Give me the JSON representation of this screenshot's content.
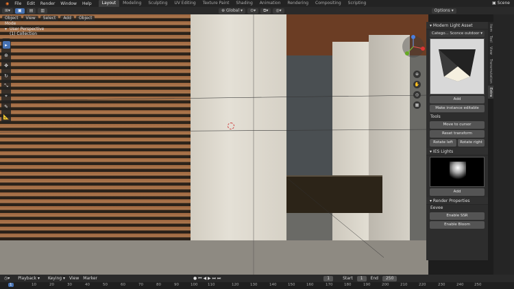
{
  "menu": [
    "File",
    "Edit",
    "Render",
    "Window",
    "Help"
  ],
  "workspaces": [
    "Layout",
    "Modeling",
    "Sculpting",
    "UV Editing",
    "Texture Paint",
    "Shading",
    "Animation",
    "Rendering",
    "Compositing",
    "Scripting"
  ],
  "active_workspace": "Layout",
  "scene_label": "Scene",
  "header": {
    "transform_orientation": "Global",
    "options": "Options"
  },
  "viewport_header": {
    "mode": "Object Mode",
    "view": "View",
    "select": "Select",
    "add": "Add",
    "object": "Object"
  },
  "viewport_overlay": {
    "line1": "User Perspective",
    "line2": "(1) Collection"
  },
  "sidebar": {
    "tabs": [
      "Item",
      "Tool",
      "View",
      "Transmutation",
      "Extra"
    ],
    "panel1_title": "Modern Light Asset",
    "category_label": "Catego...",
    "category_value": "Sconce outdoor",
    "add_button": "Add",
    "make_instance_button": "Make instance editable",
    "tools_label": "Tools",
    "move_to_cursor": "Move to cursor",
    "reset_transform": "Reset transform",
    "rotate_left": "Rotate left",
    "rotate_right": "Rotate right",
    "panel2_title": "IES Lights",
    "add_button2": "Add",
    "panel3_title": "Render Properties",
    "engine_label": "Eevee",
    "enable_ssr": "Enable SSR",
    "enable_bloom": "Enable Bloom"
  },
  "timeline": {
    "playback": "Playback",
    "keying": "Keying",
    "view": "View",
    "marker": "Marker",
    "current_frame": "1",
    "start_label": "Start",
    "start_value": "1",
    "end_label": "End",
    "end_value": "250",
    "ruler": [
      "1",
      "10",
      "20",
      "30",
      "40",
      "50",
      "60",
      "70",
      "80",
      "90",
      "100",
      "110",
      "120",
      "130",
      "140",
      "150",
      "160",
      "170",
      "180",
      "190",
      "200",
      "210",
      "220",
      "230",
      "240",
      "250"
    ]
  }
}
